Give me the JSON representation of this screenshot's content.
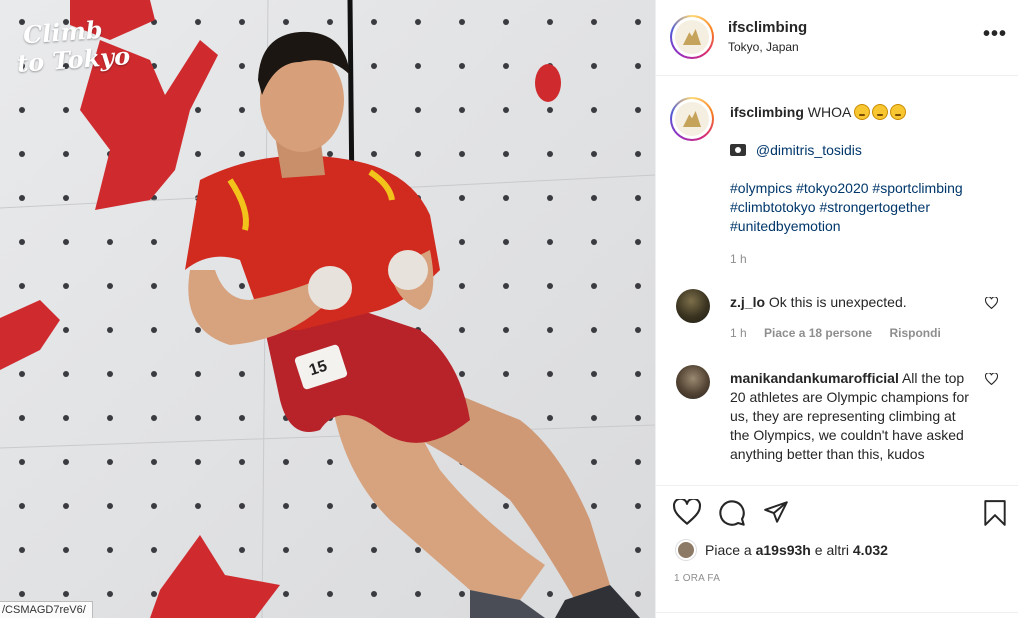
{
  "photo": {
    "brand_line1": "Climb",
    "brand_line2": "to Tokyo",
    "bib_number": "15",
    "url_fragment": "/CSMAGD7reV6/"
  },
  "header": {
    "username": "ifsclimbing",
    "location": "Tokyo, Japan",
    "more_icon": "more-horizontal-icon",
    "more_label": "•••"
  },
  "caption": {
    "username": "ifsclimbing",
    "text": "WHOA",
    "emoji_icon": "grimacing-face-icon",
    "camera_icon": "camera-icon",
    "credit": "@dimitris_tosidis",
    "hashtags_line1": "#olympics #tokyo2020 #sportclimbing",
    "hashtags_line2": "#climbtotokyo #strongertogether",
    "hashtags_line3": "#unitedbyemotion",
    "time": "1 h"
  },
  "comments": [
    {
      "username": "z.j_lo",
      "text": "Ok this is unexpected.",
      "time": "1 h",
      "likes": "Piace a 18 persone",
      "reply": "Rispondi"
    },
    {
      "username": "manikandankumarofficial",
      "text": "All the top 20 athletes are Olympic champions for us, they are representing climbing at the Olympics, we couldn't have asked anything better than this, kudos"
    }
  ],
  "actions": {
    "like_icon": "heart-icon",
    "comment_icon": "comment-icon",
    "share_icon": "send-icon",
    "save_icon": "bookmark-icon"
  },
  "likes": {
    "prefix": "Piace a",
    "user": "a19s93h",
    "suffix": "e altri",
    "count": "4.032"
  },
  "post_time": "1 ORA FA",
  "colors": {
    "link": "#00376b",
    "muted": "#8e8e8e",
    "jersey": "#d12a1f",
    "hold": "#cf2b2f"
  }
}
